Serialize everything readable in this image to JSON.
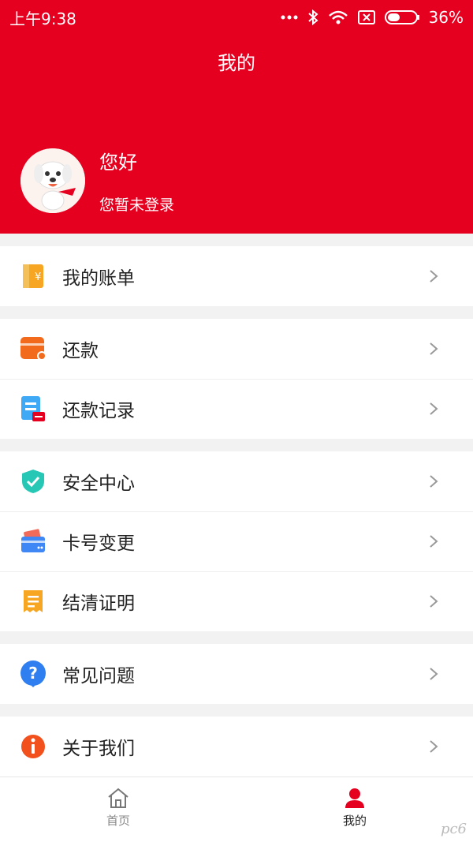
{
  "status_bar": {
    "time": "上午9:38",
    "battery": "36%"
  },
  "header": {
    "title": "我的",
    "greeting": "您好",
    "login_hint": "您暂未登录"
  },
  "sections": [
    {
      "items": [
        {
          "label": "我的账单",
          "icon": "bill-icon"
        }
      ]
    },
    {
      "items": [
        {
          "label": "还款",
          "icon": "wallet-icon"
        },
        {
          "label": "还款记录",
          "icon": "document-icon"
        }
      ]
    },
    {
      "items": [
        {
          "label": "安全中心",
          "icon": "shield-icon"
        },
        {
          "label": "卡号变更",
          "icon": "card-icon"
        },
        {
          "label": "结清证明",
          "icon": "receipt-icon"
        }
      ]
    },
    {
      "items": [
        {
          "label": "常见问题",
          "icon": "question-icon"
        }
      ]
    },
    {
      "items": [
        {
          "label": "关于我们",
          "icon": "info-icon"
        }
      ]
    }
  ],
  "tabbar": {
    "home_label": "首页",
    "mine_label": "我的",
    "active": "mine"
  },
  "watermark": "pc6",
  "colors": {
    "brand_red": "#e60020",
    "text": "#222222",
    "bg": "#f2f2f2"
  }
}
